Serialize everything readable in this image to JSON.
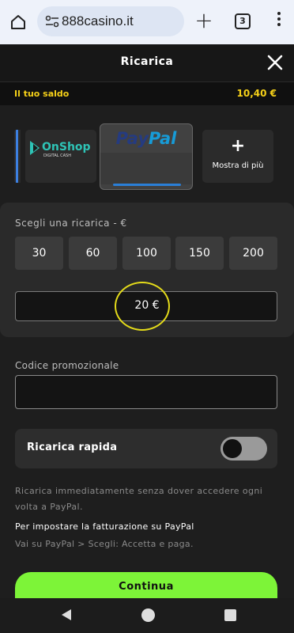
{
  "browser": {
    "url": "888casino.it",
    "tab_count": "3",
    "icons": {
      "home": "home-icon",
      "site_info": "tune-icon",
      "new_tab": "plus-icon",
      "menu": "more-vert-icon"
    }
  },
  "header": {
    "title": "Ricarica",
    "close_icon": "close-icon"
  },
  "balance": {
    "label": "Il tuo saldo",
    "value": "10,40 €"
  },
  "payment_methods": {
    "items": [
      {
        "id": "partial-card",
        "label": ""
      },
      {
        "id": "onshop",
        "logo_text": "OnShop",
        "logo_sub": "DIGITAL CASH"
      },
      {
        "id": "paypal",
        "logo_pay": "Pay",
        "logo_pal": "Pal",
        "selected": true
      },
      {
        "id": "more",
        "icon": "+",
        "label": "Mostra di più"
      }
    ]
  },
  "recharge": {
    "label": "Scegli una ricarica - €",
    "amounts": [
      "30",
      "60",
      "100",
      "150",
      "200"
    ],
    "current_value": "20 €"
  },
  "promo": {
    "label": "Codice promozionale",
    "value": ""
  },
  "rapid": {
    "label": "Ricarica rapida",
    "enabled": false
  },
  "info": {
    "line1": "Ricarica immediatamente senza dover accedere ogni volta a PayPal.",
    "line2": "Per impostare la fatturazione su PayPal",
    "line3": "Vai su PayPal > Scegli: Accetta e paga."
  },
  "continue_label": "Continua",
  "colors": {
    "accent_yellow": "#f5d018",
    "continue_green": "#7df438",
    "background": "#1e1e1e"
  }
}
